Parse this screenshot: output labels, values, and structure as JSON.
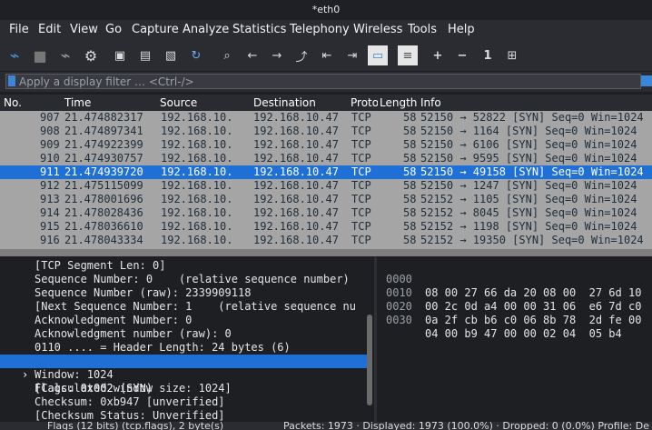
{
  "window": {
    "title": "*eth0"
  },
  "menu": [
    "File",
    "Edit",
    "View",
    "Go",
    "Capture",
    "Analyze",
    "Statistics",
    "Telephony",
    "Wireless",
    "Tools",
    "Help"
  ],
  "toolbar": {
    "icons": [
      "shark-fin-start-icon",
      "stop-square-icon",
      "shark-fin-restart-icon",
      "gear-options-icon",
      "open-file-icon",
      "file-icon",
      "close-file-icon",
      "reload-icon",
      "search-icon",
      "back-arrow-icon",
      "forward-arrow-icon",
      "jump-to-icon",
      "first-packet-icon",
      "last-packet-icon",
      "autoscroll-icon",
      "colorize-icon",
      "zoom-in-icon",
      "zoom-out-icon",
      "normal-size-icon",
      "resize-columns-icon"
    ],
    "glyphs": [
      "⌁",
      "■",
      "⌁",
      "⚙",
      "▣",
      "▤",
      "▧",
      "↻",
      "⌕",
      "←",
      "→",
      "⤴",
      "⇤",
      "⇥",
      "▭",
      "≡",
      "+",
      "−",
      "1",
      "⊞"
    ]
  },
  "filter": {
    "placeholder": "Apply a display filter … <Ctrl-/>"
  },
  "columns": [
    "No.",
    "Time",
    "Source",
    "Destination",
    "Proto",
    "Length",
    "Info"
  ],
  "packets": [
    {
      "no": "907",
      "time": "21.474882317",
      "src": "192.168.10.",
      "dst": "192.168.10.47",
      "proto": "TCP",
      "len": "58",
      "info": "52150 → 52822 [SYN] Seq=0 Win=1024"
    },
    {
      "no": "908",
      "time": "21.474897341",
      "src": "192.168.10.",
      "dst": "192.168.10.47",
      "proto": "TCP",
      "len": "58",
      "info": "52150 → 1164 [SYN] Seq=0 Win=1024"
    },
    {
      "no": "909",
      "time": "21.474922399",
      "src": "192.168.10.",
      "dst": "192.168.10.47",
      "proto": "TCP",
      "len": "58",
      "info": "52150 → 6106 [SYN] Seq=0 Win=1024"
    },
    {
      "no": "910",
      "time": "21.474930757",
      "src": "192.168.10.",
      "dst": "192.168.10.47",
      "proto": "TCP",
      "len": "58",
      "info": "52150 → 9595 [SYN] Seq=0 Win=1024"
    },
    {
      "no": "911",
      "time": "21.474939720",
      "src": "192.168.10.",
      "dst": "192.168.10.47",
      "proto": "TCP",
      "len": "58",
      "info": "52150 → 49158 [SYN] Seq=0 Win=1024"
    },
    {
      "no": "912",
      "time": "21.475115099",
      "src": "192.168.10.",
      "dst": "192.168.10.47",
      "proto": "TCP",
      "len": "58",
      "info": "52150 → 1247 [SYN] Seq=0 Win=1024"
    },
    {
      "no": "913",
      "time": "21.478001696",
      "src": "192.168.10.",
      "dst": "192.168.10.47",
      "proto": "TCP",
      "len": "58",
      "info": "52152 → 1105 [SYN] Seq=0 Win=1024"
    },
    {
      "no": "914",
      "time": "21.478028436",
      "src": "192.168.10.",
      "dst": "192.168.10.47",
      "proto": "TCP",
      "len": "58",
      "info": "52152 → 8045 [SYN] Seq=0 Win=1024"
    },
    {
      "no": "915",
      "time": "21.478036610",
      "src": "192.168.10.",
      "dst": "192.168.10.47",
      "proto": "TCP",
      "len": "58",
      "info": "52152 → 1198 [SYN] Seq=0 Win=1024"
    },
    {
      "no": "916",
      "time": "21.478043334",
      "src": "192.168.10.",
      "dst": "192.168.10.47",
      "proto": "TCP",
      "len": "58",
      "info": "52152 → 19350 [SYN] Seq=0 Win=1024"
    }
  ],
  "details": [
    "[TCP Segment Len: 0]",
    "Sequence Number: 0    (relative sequence number)",
    "Sequence Number (raw): 2339909118",
    "[Next Sequence Number: 1    (relative sequence nu",
    "Acknowledgment Number: 0",
    "Acknowledgment number (raw): 0",
    "0110 .... = Header Length: 24 bytes (6)",
    "Flags: 0x002 (SYN)",
    "Window: 1024",
    "[Calculated window size: 1024]",
    "Checksum: 0xb947 [unverified]",
    "[Checksum Status: Unverified]"
  ],
  "expand_marker": "›",
  "hex": [
    {
      "offset": "0000",
      "bytes": "08 00 27 66 da 20 08 00  27 6d 10"
    },
    {
      "offset": "0010",
      "bytes": "00 2c 0d a4 00 00 31 06  e6 7d c0"
    },
    {
      "offset": "0020",
      "bytes": "0a 2f cb b6 c0 06 8b 78  2d fe 00"
    },
    {
      "offset": "0030",
      "bytes": "04 00 b9 47 00 00 02 04  05 b4"
    }
  ],
  "status": {
    "left": "Flags (12 bits) (tcp.flags), 2 byte(s)",
    "right": "Packets: 1973 · Displayed: 1973 (100.0%) · Dropped: 0 (0.0%)   Profile: De"
  },
  "colors": {
    "selection": "#1e6fd6",
    "list_bg": "#a5a5a5",
    "accent": "#3b86d8"
  }
}
